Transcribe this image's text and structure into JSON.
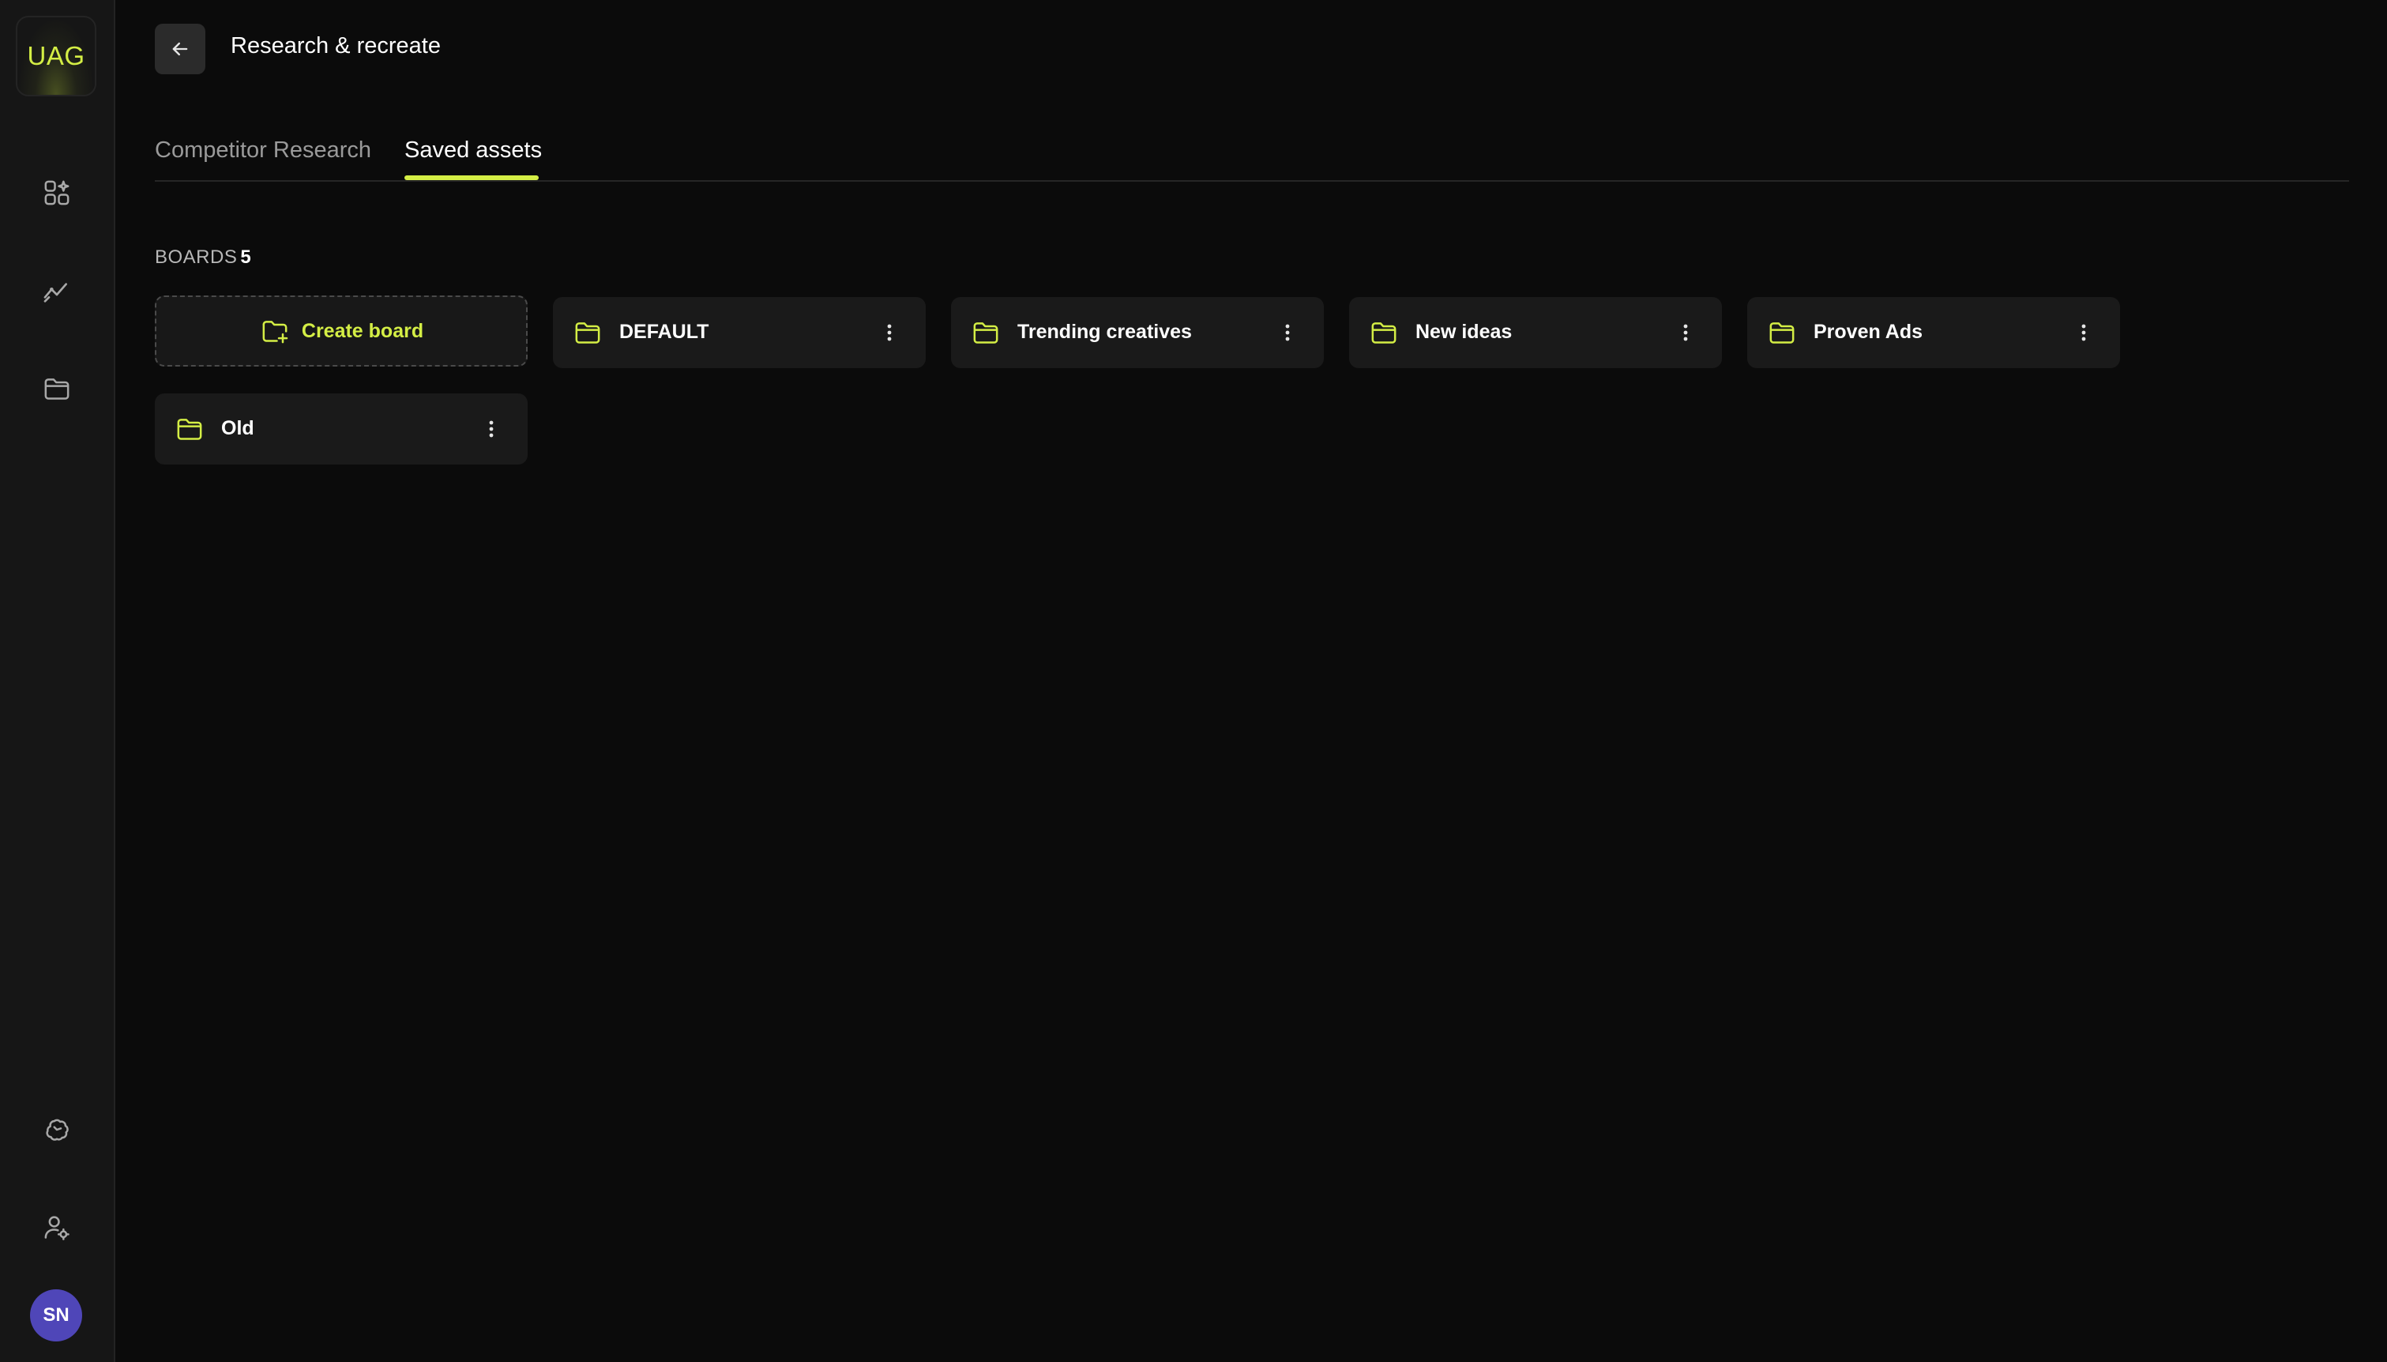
{
  "sidebar": {
    "logo_text": "UAG",
    "nav": [
      {
        "icon": "apps-icon"
      },
      {
        "icon": "analytics-icon"
      },
      {
        "icon": "folder-icon"
      }
    ],
    "bottom": [
      {
        "icon": "brain-icon"
      },
      {
        "icon": "user-settings-icon"
      }
    ],
    "avatar_initials": "SN"
  },
  "header": {
    "back_icon": "arrow-left-icon",
    "title": "Research & recreate"
  },
  "tabs": [
    {
      "label": "Competitor Research",
      "active": false
    },
    {
      "label": "Saved assets",
      "active": true
    }
  ],
  "boards": {
    "heading": "BOARDS",
    "count": "5",
    "create_label": "Create board",
    "items": [
      {
        "name": "DEFAULT"
      },
      {
        "name": "Trending creatives"
      },
      {
        "name": "New ideas"
      },
      {
        "name": "Proven Ads"
      },
      {
        "name": "Old"
      }
    ]
  },
  "colors": {
    "accent": "#d4ee45",
    "background": "#0b0b0b",
    "sidebar": "#161616",
    "card": "#1a1a1a",
    "avatar": "#4f46b8"
  }
}
